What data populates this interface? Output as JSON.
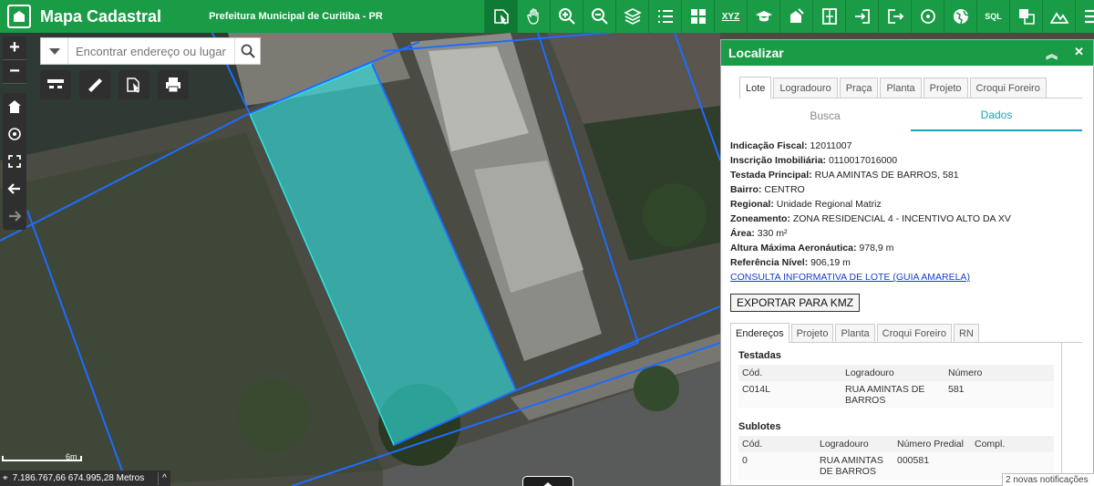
{
  "header": {
    "app_title": "Mapa Cadastral",
    "org_title": "Prefeitura Municipal de Curitiba - PR",
    "toolbar": [
      {
        "name": "identify-icon"
      },
      {
        "name": "pan-hand-icon"
      },
      {
        "name": "zoom-in-icon"
      },
      {
        "name": "zoom-out-icon"
      },
      {
        "name": "layers-icon"
      },
      {
        "name": "legend-list-icon"
      },
      {
        "name": "basemap-grid-icon"
      },
      {
        "name": "xyz-coordinates-icon",
        "label": "XYZ"
      },
      {
        "name": "education-icon"
      },
      {
        "name": "draw-area-icon"
      },
      {
        "name": "split-panel-icon"
      },
      {
        "name": "login-icon"
      },
      {
        "name": "logout-icon"
      },
      {
        "name": "target-icon"
      },
      {
        "name": "globe-icon"
      },
      {
        "name": "sql-query-icon",
        "label": "SQL"
      },
      {
        "name": "select-icon"
      },
      {
        "name": "terrain-icon"
      },
      {
        "name": "menu-icon"
      }
    ]
  },
  "map": {
    "zoom_in": "+",
    "zoom_out": "−",
    "search_placeholder": "Encontrar endereço ou lugar",
    "scale_label": "6m",
    "coords_text": "7.186.767,66 674.995,28 Metros",
    "coords_toggle": "^"
  },
  "panel": {
    "title": "Localizar",
    "tabs": [
      "Lote",
      "Logradouro",
      "Praça",
      "Planta",
      "Projeto",
      "Croqui Foreiro"
    ],
    "subtabs": [
      "Busca",
      "Dados"
    ],
    "info": [
      {
        "label": "Indicação Fiscal:",
        "value": "12011007"
      },
      {
        "label": "Inscrição Imobiliária:",
        "value": "0110017016000"
      },
      {
        "label": "Testada Principal:",
        "value": "RUA AMINTAS DE BARROS, 581"
      },
      {
        "label": "Bairro:",
        "value": "CENTRO"
      },
      {
        "label": "Regional:",
        "value": "Unidade Regional Matriz"
      },
      {
        "label": "Zoneamento:",
        "value": "ZONA RESIDENCIAL 4 - INCENTIVO ALTO DA XV"
      },
      {
        "label": "Área:",
        "value": "330 m²"
      },
      {
        "label": "Altura Máxima Aeronáutica:",
        "value": "978,9 m"
      },
      {
        "label": "Referência Nível:",
        "value": "906,19 m"
      }
    ],
    "link": "CONSULTA INFORMATIVA DE LOTE (GUIA AMARELA)",
    "export_button": "EXPORTAR PARA KMZ",
    "tabs2": [
      "Endereços",
      "Projeto",
      "Planta",
      "Croqui Foreiro",
      "RN"
    ],
    "testadas": {
      "title": "Testadas",
      "headers": [
        "Cód.",
        "Logradouro",
        "Número"
      ],
      "rows": [
        [
          "C014L",
          "RUA AMINTAS DE BARROS",
          "581"
        ]
      ]
    },
    "sublotes": {
      "title": "Sublotes",
      "headers": [
        "Cód.",
        "Logradouro",
        "Número Predial",
        "Compl."
      ],
      "rows": [
        [
          "0",
          "RUA AMINTAS DE BARROS",
          "000581",
          ""
        ]
      ]
    }
  },
  "notification": "2 novas notificações",
  "colors": {
    "brand": "#1a9b46",
    "parcel_highlight": "#2ee6e6",
    "parcel_lines": "#1e6cff"
  }
}
